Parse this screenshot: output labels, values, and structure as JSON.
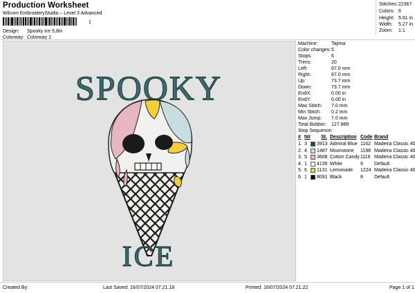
{
  "header": {
    "title": "Production Worksheet",
    "subtitle": "Wilcom EmbroideryStudio – Level 3 Advanced",
    "barcode_number": "1",
    "design_label": "Design:",
    "design_value": "Spooky ice 5,8in",
    "colorway_label": "Colorway:",
    "colorway_value": "Colorway 1"
  },
  "stats": [
    {
      "key": "Stitches:",
      "value": "22367"
    },
    {
      "key": "Colors:",
      "value": "6"
    },
    {
      "key": "Height:",
      "value": "5.81 in"
    },
    {
      "key": "Width:",
      "value": "5.27 in"
    },
    {
      "key": "Zoom:",
      "value": "1:1"
    }
  ],
  "design": {
    "top_text": "SPOOKY",
    "bottom_text": "ICE"
  },
  "machine_info": [
    {
      "key": "Machine:",
      "value": "Tajima"
    },
    {
      "key": "Color changes:",
      "value": "5"
    },
    {
      "key": "Stops:",
      "value": "6"
    },
    {
      "key": "Trims:",
      "value": "20"
    },
    {
      "key": "Left:",
      "value": "67.0 mm"
    },
    {
      "key": "Right:",
      "value": "67.0 mm"
    },
    {
      "key": "Up:",
      "value": "73.7 mm"
    },
    {
      "key": "Down:",
      "value": "73.7 mm"
    },
    {
      "key": "EndX:",
      "value": "0.00 in"
    },
    {
      "key": "EndY:",
      "value": "0.00 in"
    },
    {
      "key": "Max Stitch:",
      "value": "7.0 mm"
    },
    {
      "key": "Min Stitch:",
      "value": "0.2 mm"
    },
    {
      "key": "Max Jump:",
      "value": "7.0 mm"
    },
    {
      "key": "Total Bobbin:",
      "value": "127.86ft"
    }
  ],
  "stop_sequence": {
    "title": "Stop Sequence:",
    "headers": {
      "num": "#",
      "n": "N#",
      "st": "St.",
      "description": "Description",
      "code": "Code",
      "brand": "Brand"
    },
    "rows": [
      {
        "num": "1.",
        "n": "3",
        "color": "#1f4f5c",
        "st": "3913",
        "description": "Admiral Blue",
        "code": "1162",
        "brand": "Madeira Classic 40"
      },
      {
        "num": "2.",
        "n": "4",
        "color": "#c9dde0",
        "st": "1487",
        "description": "Moonstone",
        "code": "1198",
        "brand": "Madeira Classic 40"
      },
      {
        "num": "3.",
        "n": "5",
        "color": "#e6b7bf",
        "st": "3608",
        "description": "Cotton Candy",
        "code": "1116",
        "brand": "Madeira Classic 40"
      },
      {
        "num": "4.",
        "n": "1",
        "color": "#ffffff",
        "st": "4135",
        "description": "White",
        "code": "9",
        "brand": "Default"
      },
      {
        "num": "5.",
        "n": "6",
        "color": "#f0cf3a",
        "st": "1131",
        "description": "Lemonade",
        "code": "1224",
        "brand": "Madeira Classic 40"
      },
      {
        "num": "6.",
        "n": "1",
        "color": "#111111",
        "st": "8091",
        "description": "Black",
        "code": "8",
        "brand": "Default"
      }
    ]
  },
  "footer": {
    "created_by": "Created By:",
    "last_saved": "Last Saved: 16/07/2024 07.21.18",
    "printed": "Printed: 16/07/2024 07.21.22",
    "page": "Page 1 of 1"
  }
}
